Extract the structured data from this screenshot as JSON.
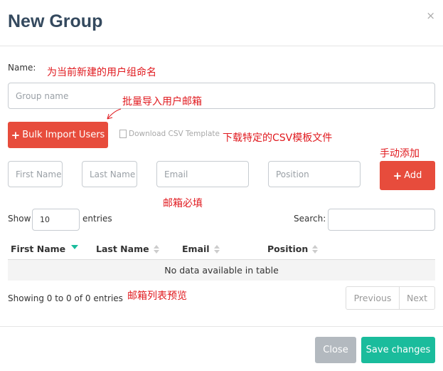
{
  "modal": {
    "title": "New Group",
    "close_glyph": "×"
  },
  "form": {
    "name_label": "Name:",
    "group_name_placeholder": "Group name",
    "bulk_import_label": "Bulk Import Users",
    "download_csv_label": "Download CSV Template",
    "first_name_placeholder": "First Name",
    "last_name_placeholder": "Last Name",
    "email_placeholder": "Email",
    "position_placeholder": "Position",
    "add_label": "Add"
  },
  "annotations": {
    "name_note": "为当前新建的用户组命名",
    "bulk_note": "批量导入用户邮箱",
    "csv_note": "下载特定的CSV模板文件",
    "add_note": "手动添加",
    "email_note": "邮箱必填",
    "table_note": "邮箱列表预览"
  },
  "table": {
    "show_label": "Show",
    "entries_value": "10",
    "entries_label": "entries",
    "search_label": "Search:",
    "columns": [
      "First Name",
      "Last Name",
      "Email",
      "Position"
    ],
    "empty_message": "No data available in table",
    "info": "Showing 0 to 0 of 0 entries",
    "prev_label": "Previous",
    "next_label": "Next"
  },
  "footer": {
    "close_label": "Close",
    "save_label": "Save changes"
  },
  "colors": {
    "accent_red": "#e74c3c",
    "accent_green": "#1abc9c",
    "title": "#34495e",
    "annotation": "#e0191e"
  },
  "icons": [
    "close-icon",
    "plus-icon",
    "document-icon",
    "sort-icon",
    "arrow-annotation-icon"
  ]
}
